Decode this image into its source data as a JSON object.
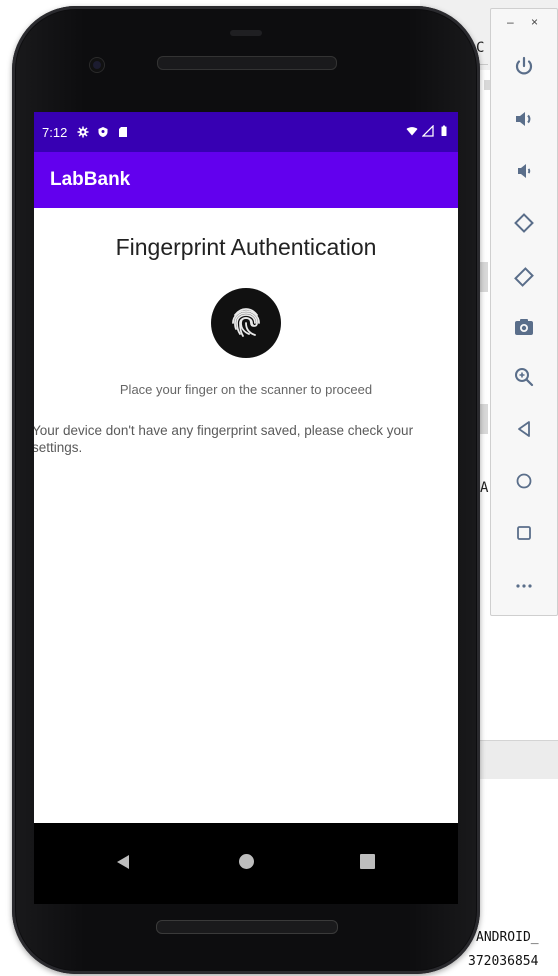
{
  "background": {
    "ide_fragment_top": "C",
    "ide_fragment_mid": "A",
    "console_line_1": "ANDROID_",
    "console_line_2": "372036854",
    "window_controls": {
      "minimize": "–",
      "close": "×"
    }
  },
  "emulator_toolbar": {
    "buttons": [
      {
        "name": "power",
        "icon": "power-icon"
      },
      {
        "name": "volume-up",
        "icon": "volume-up-icon"
      },
      {
        "name": "volume-down",
        "icon": "volume-down-icon"
      },
      {
        "name": "rotate-left",
        "icon": "rotate-left-icon"
      },
      {
        "name": "rotate-right",
        "icon": "rotate-right-icon"
      },
      {
        "name": "screenshot",
        "icon": "camera-icon"
      },
      {
        "name": "zoom",
        "icon": "zoom-in-icon"
      },
      {
        "name": "back",
        "icon": "back-triangle-icon"
      },
      {
        "name": "home",
        "icon": "home-circle-icon"
      },
      {
        "name": "overview",
        "icon": "overview-square-icon"
      },
      {
        "name": "more",
        "icon": "more-icon"
      }
    ]
  },
  "status_bar": {
    "time": "7:12",
    "left_icons": [
      "settings-icon",
      "shield-icon",
      "sd-card-icon"
    ],
    "right_icons": [
      "wifi-icon",
      "signal-icon",
      "battery-icon"
    ]
  },
  "app_bar": {
    "title": "LabBank"
  },
  "fingerprint": {
    "title": "Fingerprint Authentication",
    "icon": "fingerprint-icon",
    "instruction": "Place your finger on the scanner to proceed",
    "error": "Your device don't have any fingerprint saved, please check your settings."
  },
  "nav_bar": {
    "icons": [
      "nav-back-icon",
      "nav-home-icon",
      "nav-recents-icon"
    ]
  },
  "colors": {
    "status_bar": "#3700b3",
    "app_bar": "#6200ee",
    "nav_bar": "#000000"
  }
}
